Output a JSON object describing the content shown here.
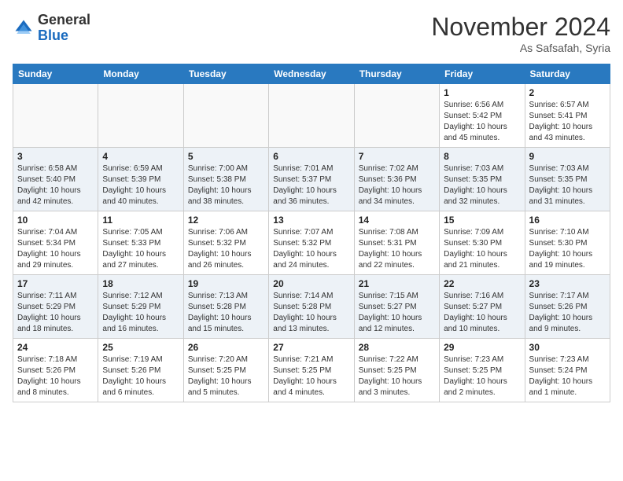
{
  "header": {
    "logo_line1": "General",
    "logo_line2": "Blue",
    "month": "November 2024",
    "location": "As Safsafah, Syria"
  },
  "weekdays": [
    "Sunday",
    "Monday",
    "Tuesday",
    "Wednesday",
    "Thursday",
    "Friday",
    "Saturday"
  ],
  "weeks": [
    [
      {
        "day": "",
        "info": ""
      },
      {
        "day": "",
        "info": ""
      },
      {
        "day": "",
        "info": ""
      },
      {
        "day": "",
        "info": ""
      },
      {
        "day": "",
        "info": ""
      },
      {
        "day": "1",
        "info": "Sunrise: 6:56 AM\nSunset: 5:42 PM\nDaylight: 10 hours\nand 45 minutes."
      },
      {
        "day": "2",
        "info": "Sunrise: 6:57 AM\nSunset: 5:41 PM\nDaylight: 10 hours\nand 43 minutes."
      }
    ],
    [
      {
        "day": "3",
        "info": "Sunrise: 6:58 AM\nSunset: 5:40 PM\nDaylight: 10 hours\nand 42 minutes."
      },
      {
        "day": "4",
        "info": "Sunrise: 6:59 AM\nSunset: 5:39 PM\nDaylight: 10 hours\nand 40 minutes."
      },
      {
        "day": "5",
        "info": "Sunrise: 7:00 AM\nSunset: 5:38 PM\nDaylight: 10 hours\nand 38 minutes."
      },
      {
        "day": "6",
        "info": "Sunrise: 7:01 AM\nSunset: 5:37 PM\nDaylight: 10 hours\nand 36 minutes."
      },
      {
        "day": "7",
        "info": "Sunrise: 7:02 AM\nSunset: 5:36 PM\nDaylight: 10 hours\nand 34 minutes."
      },
      {
        "day": "8",
        "info": "Sunrise: 7:03 AM\nSunset: 5:35 PM\nDaylight: 10 hours\nand 32 minutes."
      },
      {
        "day": "9",
        "info": "Sunrise: 7:03 AM\nSunset: 5:35 PM\nDaylight: 10 hours\nand 31 minutes."
      }
    ],
    [
      {
        "day": "10",
        "info": "Sunrise: 7:04 AM\nSunset: 5:34 PM\nDaylight: 10 hours\nand 29 minutes."
      },
      {
        "day": "11",
        "info": "Sunrise: 7:05 AM\nSunset: 5:33 PM\nDaylight: 10 hours\nand 27 minutes."
      },
      {
        "day": "12",
        "info": "Sunrise: 7:06 AM\nSunset: 5:32 PM\nDaylight: 10 hours\nand 26 minutes."
      },
      {
        "day": "13",
        "info": "Sunrise: 7:07 AM\nSunset: 5:32 PM\nDaylight: 10 hours\nand 24 minutes."
      },
      {
        "day": "14",
        "info": "Sunrise: 7:08 AM\nSunset: 5:31 PM\nDaylight: 10 hours\nand 22 minutes."
      },
      {
        "day": "15",
        "info": "Sunrise: 7:09 AM\nSunset: 5:30 PM\nDaylight: 10 hours\nand 21 minutes."
      },
      {
        "day": "16",
        "info": "Sunrise: 7:10 AM\nSunset: 5:30 PM\nDaylight: 10 hours\nand 19 minutes."
      }
    ],
    [
      {
        "day": "17",
        "info": "Sunrise: 7:11 AM\nSunset: 5:29 PM\nDaylight: 10 hours\nand 18 minutes."
      },
      {
        "day": "18",
        "info": "Sunrise: 7:12 AM\nSunset: 5:29 PM\nDaylight: 10 hours\nand 16 minutes."
      },
      {
        "day": "19",
        "info": "Sunrise: 7:13 AM\nSunset: 5:28 PM\nDaylight: 10 hours\nand 15 minutes."
      },
      {
        "day": "20",
        "info": "Sunrise: 7:14 AM\nSunset: 5:28 PM\nDaylight: 10 hours\nand 13 minutes."
      },
      {
        "day": "21",
        "info": "Sunrise: 7:15 AM\nSunset: 5:27 PM\nDaylight: 10 hours\nand 12 minutes."
      },
      {
        "day": "22",
        "info": "Sunrise: 7:16 AM\nSunset: 5:27 PM\nDaylight: 10 hours\nand 10 minutes."
      },
      {
        "day": "23",
        "info": "Sunrise: 7:17 AM\nSunset: 5:26 PM\nDaylight: 10 hours\nand 9 minutes."
      }
    ],
    [
      {
        "day": "24",
        "info": "Sunrise: 7:18 AM\nSunset: 5:26 PM\nDaylight: 10 hours\nand 8 minutes."
      },
      {
        "day": "25",
        "info": "Sunrise: 7:19 AM\nSunset: 5:26 PM\nDaylight: 10 hours\nand 6 minutes."
      },
      {
        "day": "26",
        "info": "Sunrise: 7:20 AM\nSunset: 5:25 PM\nDaylight: 10 hours\nand 5 minutes."
      },
      {
        "day": "27",
        "info": "Sunrise: 7:21 AM\nSunset: 5:25 PM\nDaylight: 10 hours\nand 4 minutes."
      },
      {
        "day": "28",
        "info": "Sunrise: 7:22 AM\nSunset: 5:25 PM\nDaylight: 10 hours\nand 3 minutes."
      },
      {
        "day": "29",
        "info": "Sunrise: 7:23 AM\nSunset: 5:25 PM\nDaylight: 10 hours\nand 2 minutes."
      },
      {
        "day": "30",
        "info": "Sunrise: 7:23 AM\nSunset: 5:24 PM\nDaylight: 10 hours\nand 1 minute."
      }
    ]
  ]
}
